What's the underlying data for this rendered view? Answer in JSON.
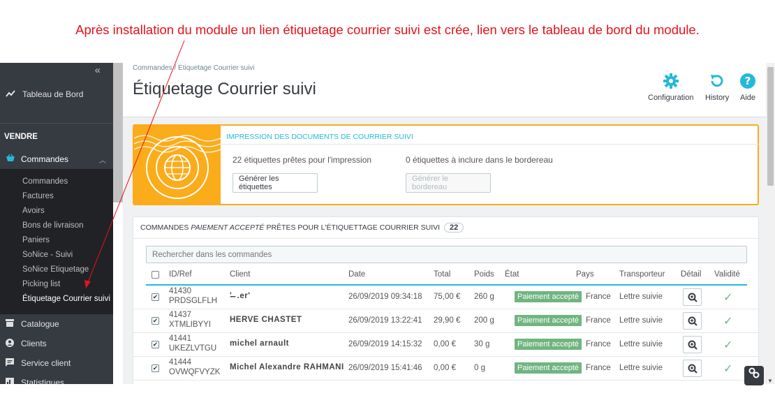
{
  "annotation": "Après installation du module un lien étiquetage courrier suivi est crée, lien vers le tableau de bord du module.",
  "sidebar": {
    "collapse": "«",
    "dashboard": "Tableau de Bord",
    "section": "VENDRE",
    "commandes": "Commandes",
    "sub": [
      "Commandes",
      "Factures",
      "Avoirs",
      "Bons de livraison",
      "Paniers",
      "SoNice - Suivi",
      "SoNice Etiquetage",
      "Picking list",
      "Étiquetage Courrier suivi"
    ],
    "catalogue": "Catalogue",
    "clients": "Clients",
    "service": "Service client",
    "stats": "Statistiques"
  },
  "header": {
    "breadcrumb": "Commandes  /  Etiquetage Courrier suivi",
    "title": "Étiquetage Courrier suivi",
    "config": "Configuration",
    "history": "History",
    "help": "Aide"
  },
  "print_panel": {
    "title": "IMPRESSION DES DOCUMENTS DE COURRIER SUIVI",
    "ready": "22 étiquettes prêtes pour l'impression",
    "bordereau": "0 étiquettes à inclure dans le bordereau",
    "btn_labels": "Générer les étiquettes",
    "btn_bordereau": "Générer le bordereau"
  },
  "orders_panel": {
    "title_pre": "COMMANDES",
    "title_em": "PAIEMENT ACCEPTÉ",
    "title_post": "PRÊTES POUR L'ÉTIQUETTAGE COURRIER SUIVI",
    "count": "22",
    "search_placeholder": "Rechercher dans les commandes",
    "columns": [
      "ID/Ref",
      "Client",
      "Date",
      "Total",
      "Poids",
      "État",
      "Pays",
      "Transporteur",
      "Détail",
      "Validité"
    ],
    "rows": [
      {
        "id": "41430",
        "ref": "PRDSGLFLH",
        "client": "'̵̵̵̵̵ ̵̵̵̵ .er'",
        "date": "26/09/2019 09:34:18",
        "total": "75,00 €",
        "poids": "260 g",
        "etat": "Paiement accepté",
        "pays": "France",
        "transporteur": "Lettre suivie"
      },
      {
        "id": "41437",
        "ref": "XTMLIBYYI",
        "client": "HERVE CHASTET",
        "date": "26/09/2019 13:22:41",
        "total": "29,90 €",
        "poids": "200 g",
        "etat": "Paiement accepté",
        "pays": "France",
        "transporteur": "Lettre suivie"
      },
      {
        "id": "41441",
        "ref": "UKEZLVTGU",
        "client": "michel arnault",
        "date": "26/09/2019 14:15:32",
        "total": "0,00 €",
        "poids": "30 g",
        "etat": "Paiement accepté",
        "pays": "France",
        "transporteur": "Lettre suivie"
      },
      {
        "id": "41444",
        "ref": "OVWQFVYZK",
        "client": "Michel Alexandre RAHMANI",
        "date": "26/09/2019 15:41:46",
        "total": "0,00 €",
        "poids": "0 g",
        "etat": "Paiement accepté",
        "pays": "France",
        "transporteur": "Lettre suivie"
      }
    ]
  },
  "colors": {
    "accent": "#25b9d7",
    "orange": "#fbac1b",
    "success": "#70b580",
    "sidebar": "#363a41",
    "annotation": "#e8111b"
  }
}
